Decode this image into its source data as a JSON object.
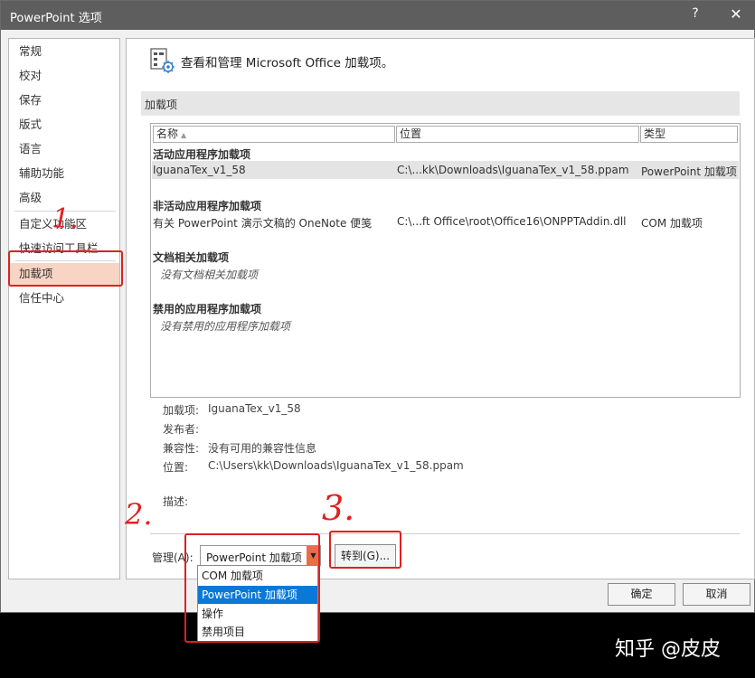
{
  "window": {
    "title": "PowerPoint 选项",
    "help": "?",
    "close": "✕"
  },
  "sidebar": {
    "items": [
      {
        "label": "常规"
      },
      {
        "label": "校对"
      },
      {
        "label": "保存"
      },
      {
        "label": "版式"
      },
      {
        "label": "语言"
      },
      {
        "label": "辅助功能"
      },
      {
        "label": "高级"
      },
      {
        "label": "自定义功能区"
      },
      {
        "label": "快速访问工具栏"
      },
      {
        "label": "加载项"
      },
      {
        "label": "信任中心"
      }
    ],
    "selected": "加载项"
  },
  "main": {
    "heading": "查看和管理 Microsoft Office 加载项。",
    "section_title": "加载项",
    "columns": {
      "name": "名称",
      "location": "位置",
      "type": "类型"
    },
    "groups": {
      "active": {
        "title": "活动应用程序加载项",
        "row": {
          "name": "IguanaTex_v1_58",
          "location": "C:\\...kk\\Downloads\\IguanaTex_v1_58.ppam",
          "type": "PowerPoint 加载项"
        }
      },
      "inactive": {
        "title": "非活动应用程序加载项",
        "row": {
          "name": "有关 PowerPoint 演示文稿的 OneNote 便笺",
          "location": "C:\\...ft Office\\root\\Office16\\ONPPTAddin.dll",
          "type": "COM 加载项"
        }
      },
      "document": {
        "title": "文档相关加载项",
        "empty": "没有文档相关加载项"
      },
      "disabled": {
        "title": "禁用的应用程序加载项",
        "empty": "没有禁用的应用程序加载项"
      }
    },
    "details": {
      "addin_label": "加载项:",
      "addin_value": "IguanaTex_v1_58",
      "publisher_label": "发布者:",
      "publisher_value": "",
      "compat_label": "兼容性:",
      "compat_value": "没有可用的兼容性信息",
      "location_label": "位置:",
      "location_value": "C:\\Users\\kk\\Downloads\\IguanaTex_v1_58.ppam",
      "desc_label": "描述:"
    },
    "manage": {
      "label": "管理(A):",
      "selected": "PowerPoint 加载项",
      "go_button": "转到(G)...",
      "options": [
        "COM 加载项",
        "PowerPoint 加载项",
        "操作",
        "禁用项目"
      ],
      "highlighted_option": "PowerPoint 加载项"
    }
  },
  "footer": {
    "ok": "确定",
    "cancel": "取消"
  },
  "annotations": {
    "n1": "1.",
    "n2": "2.",
    "n3": "3."
  },
  "watermark": "知乎 @皮皮",
  "colors": {
    "annotation": "#e02020",
    "selection": "#0a78d7",
    "sidebar_selected": "#f8d4c4",
    "titlebar": "#5e5e5e"
  }
}
